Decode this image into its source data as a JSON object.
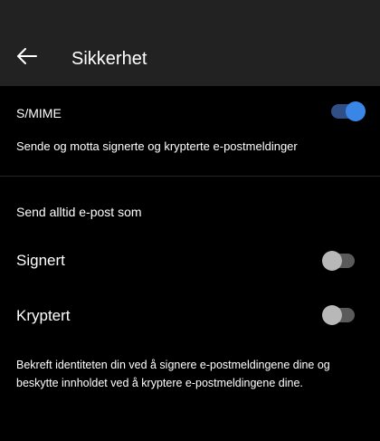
{
  "header": {
    "title": "Sikkerhet",
    "back_icon": "arrow-left-icon"
  },
  "smime": {
    "label": "S/MIME",
    "enabled": true,
    "description": "Sende og motta signerte og krypterte e-postmeldinger"
  },
  "send_always": {
    "header": "Send alltid e-post som",
    "options": [
      {
        "label": "Signert",
        "enabled": false
      },
      {
        "label": "Kryptert",
        "enabled": false
      }
    ]
  },
  "footer": {
    "text": "Bekreft identiteten din ved å signere e-postmeldingene dine og beskytte innholdet ved å kryptere e-postmeldingene dine."
  },
  "colors": {
    "background": "#000000",
    "app_bar": "#222222",
    "toggle_on_thumb": "#3a86e6",
    "toggle_on_track": "#2f4f86",
    "toggle_off_thumb": "#b8b8b8",
    "toggle_off_track": "#5a5a5a"
  }
}
